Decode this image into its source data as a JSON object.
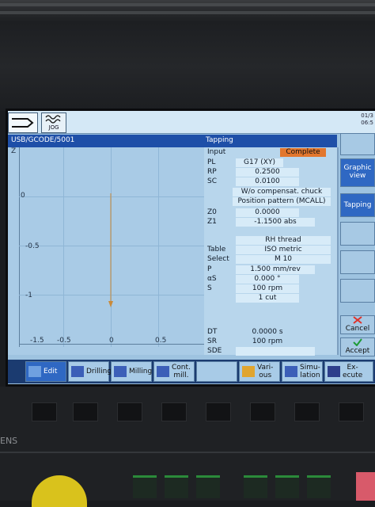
{
  "header": {
    "mode": "JOG",
    "date_line1": "01/3",
    "date_line2": "06:5"
  },
  "path": "USB/GCODE/5001",
  "panel_title": "Tapping",
  "graph": {
    "z_label": "Z",
    "y_ticks": [
      "0",
      "-0.5",
      "-1",
      "-1.5"
    ],
    "x_ticks": [
      "-0.5",
      "0",
      "0.5"
    ]
  },
  "params": {
    "input_label": "Input",
    "input_value": "Complete",
    "rows": [
      {
        "label": "PL",
        "value": "G17 (XY)"
      },
      {
        "label": "RP",
        "value": "0.2500"
      },
      {
        "label": "SC",
        "value": "0.0100"
      },
      {
        "label": "",
        "value": "W/o compensat. chuck"
      },
      {
        "label": "",
        "value": "Position pattern (MCALL)"
      },
      {
        "label": "Z0",
        "value": "0.0000"
      },
      {
        "label": "Z1",
        "value": "-1.1500 abs"
      },
      {
        "label": "",
        "value": "RH thread"
      },
      {
        "label": "Table",
        "value": "ISO metric"
      },
      {
        "label": "Select",
        "value": "M 10"
      },
      {
        "label": "P",
        "value": "1.500 mm/rev"
      },
      {
        "label": "αS",
        "value": "0.000 °"
      },
      {
        "label": "S",
        "value": "100 rpm"
      },
      {
        "label": "",
        "value": "1 cut"
      },
      {
        "label": "DT",
        "value": "0.0000 s"
      },
      {
        "label": "SR",
        "value": "100 rpm"
      },
      {
        "label": "SDE",
        "value": ""
      }
    ]
  },
  "side_softkeys": {
    "graphic_view": "Graphic view",
    "tapping": "Tapping",
    "cancel": "Cancel",
    "accept": "Accept"
  },
  "bottom_softkeys": {
    "edit": "Edit",
    "drilling": "Drilling",
    "milling": "Milling",
    "cont_mill_1": "Cont.",
    "cont_mill_2": "mill.",
    "various_1": "Vari-",
    "various_2": "ous",
    "simulation_1": "Simu-",
    "simulation_2": "lation",
    "execute_1": "Ex-",
    "execute_2": "ecute"
  },
  "brand_fragment": "ENS",
  "colors": {
    "header_blue": "#1e4fa8",
    "complete_orange": "#e2772e",
    "screen_bg": "#a9cbe6"
  }
}
